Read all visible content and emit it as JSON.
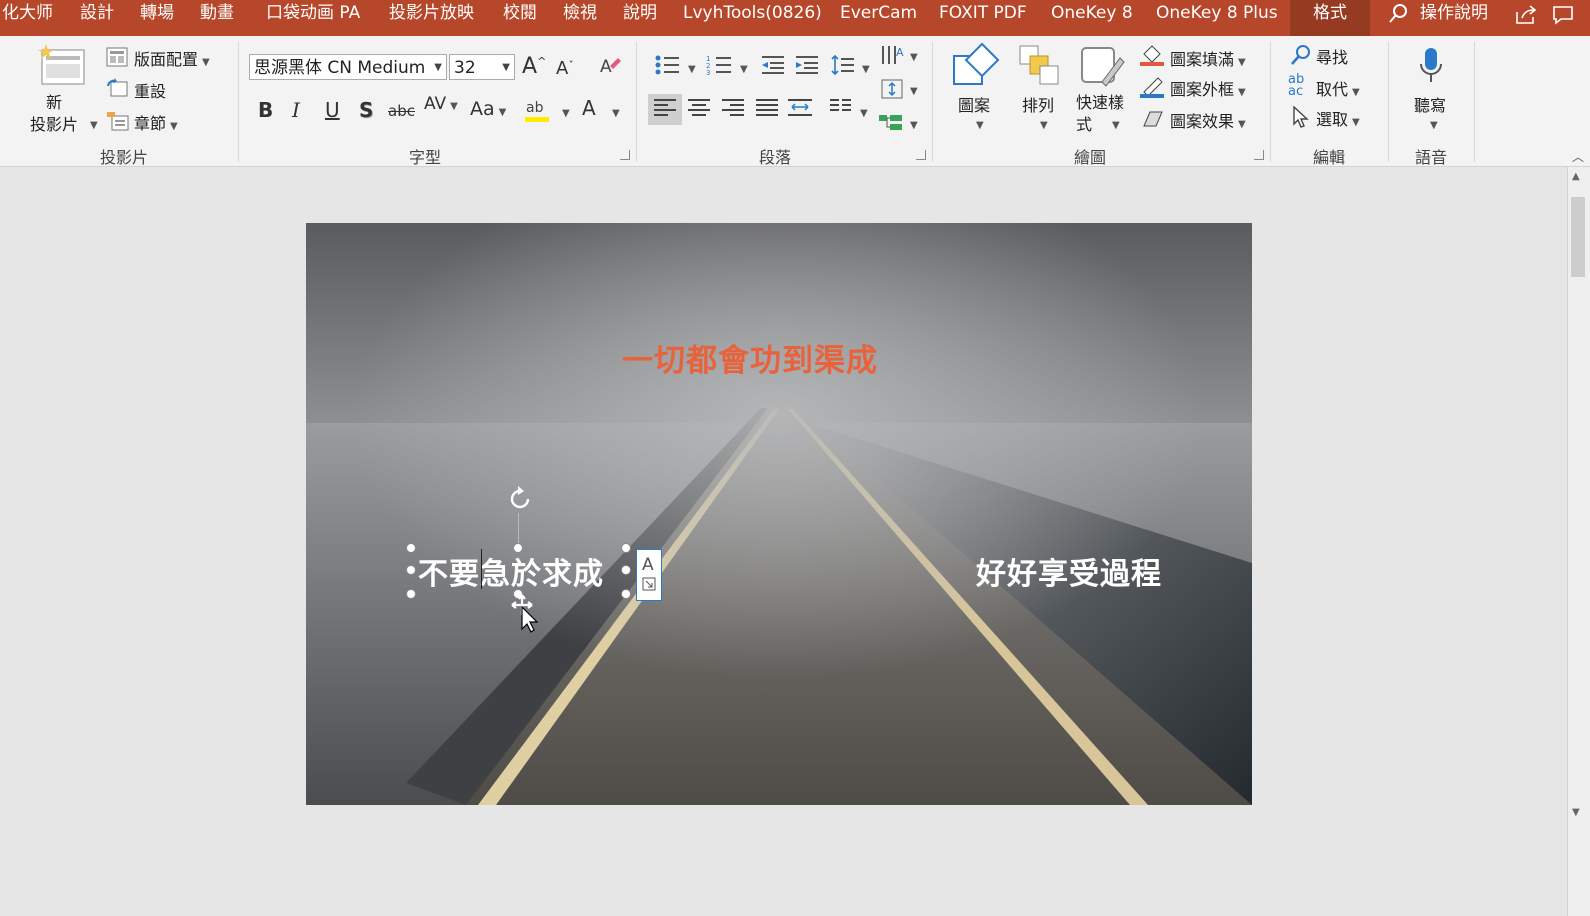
{
  "tabs": [
    "化大师",
    "設計",
    "轉場",
    "動畫",
    "口袋动画 PA",
    "投影片放映",
    "校閱",
    "檢視",
    "說明",
    "LvyhTools(0826)",
    "EverCam",
    "FOXIT PDF",
    "OneKey 8",
    "OneKey 8 Plus",
    "格式",
    "操作說明"
  ],
  "ribbon": {
    "slides": {
      "new_slide_label": "新\n投影片",
      "layout": "版面配置",
      "reset": "重設",
      "section": "章節",
      "group": "投影片"
    },
    "font": {
      "font_name": "思源黑体 CN Medium",
      "font_size": "32",
      "group": "字型"
    },
    "paragraph": {
      "group": "段落"
    },
    "drawing": {
      "shapes": "圖案",
      "arrange": "排列",
      "quick_styles": "快速樣\n式",
      "fill": "圖案填滿",
      "outline": "圖案外框",
      "effects": "圖案效果",
      "group": "繪圖"
    },
    "editing": {
      "find": "尋找",
      "replace": "取代",
      "select": "選取",
      "group": "編輯"
    },
    "voice": {
      "dictate": "聽寫",
      "group": "語音"
    }
  },
  "slide": {
    "title": "一切都會功到渠成",
    "left_text": "不要急於求成",
    "right_text": "好好享受過程"
  },
  "colors": {
    "accent": "#b7472a",
    "title": "#e8623b"
  }
}
